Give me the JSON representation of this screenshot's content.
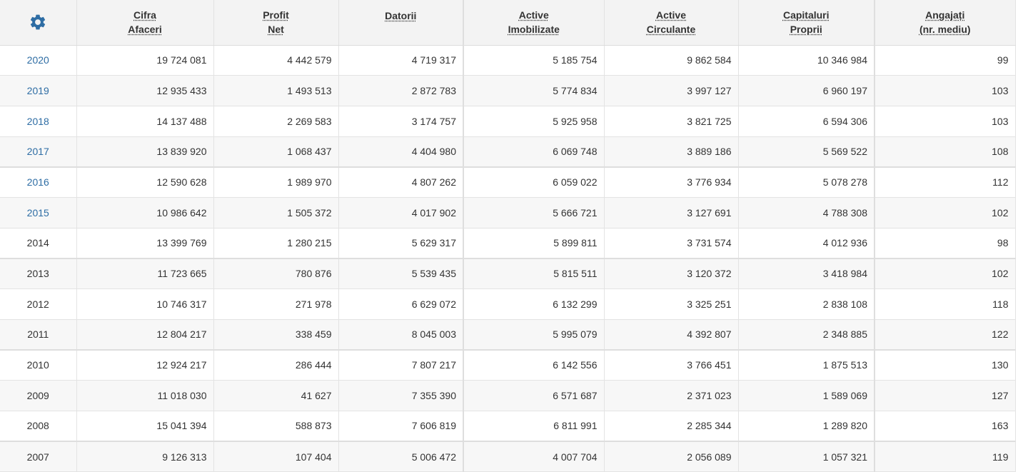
{
  "columns": [
    {
      "key": "settings",
      "icon": "gear-icon"
    },
    {
      "key": "cifra_afaceri",
      "lines": [
        "Cifra",
        "Afaceri"
      ]
    },
    {
      "key": "profit_net",
      "lines": [
        "Profit",
        "Net"
      ]
    },
    {
      "key": "datorii",
      "lines": [
        "Datorii",
        ""
      ]
    },
    {
      "key": "active_imobilizate",
      "lines": [
        "Active",
        "Imobilizate"
      ]
    },
    {
      "key": "active_circulante",
      "lines": [
        "Active",
        "Circulante"
      ]
    },
    {
      "key": "capitaluri_proprii",
      "lines": [
        "Capitaluri",
        "Proprii"
      ]
    },
    {
      "key": "angajati",
      "lines": [
        "Angajați",
        "(nr. mediu)"
      ]
    }
  ],
  "colors": {
    "link": "#2e6da4",
    "gear": "#2e6da4",
    "header_bg": "#f3f3f3",
    "row_alt_bg": "#f7f7f7"
  },
  "rows": [
    {
      "year": "2020",
      "link": true,
      "values": [
        "19 724 081",
        "4 442 579",
        "4 719 317",
        "5 185 754",
        "9 862 584",
        "10 346 984",
        "99"
      ]
    },
    {
      "year": "2019",
      "link": true,
      "values": [
        "12 935 433",
        "1 493 513",
        "2 872 783",
        "5 774 834",
        "3 997 127",
        "6 960 197",
        "103"
      ]
    },
    {
      "year": "2018",
      "link": true,
      "values": [
        "14 137 488",
        "2 269 583",
        "3 174 757",
        "5 925 958",
        "3 821 725",
        "6 594 306",
        "103"
      ]
    },
    {
      "year": "2017",
      "link": true,
      "values": [
        "13 839 920",
        "1 068 437",
        "4 404 980",
        "6 069 748",
        "3 889 186",
        "5 569 522",
        "108"
      ]
    },
    {
      "year": "2016",
      "link": true,
      "values": [
        "12 590 628",
        "1 989 970",
        "4 807 262",
        "6 059 022",
        "3 776 934",
        "5 078 278",
        "112"
      ]
    },
    {
      "year": "2015",
      "link": true,
      "values": [
        "10 986 642",
        "1 505 372",
        "4 017 902",
        "5 666 721",
        "3 127 691",
        "4 788 308",
        "102"
      ]
    },
    {
      "year": "2014",
      "link": false,
      "values": [
        "13 399 769",
        "1 280 215",
        "5 629 317",
        "5 899 811",
        "3 731 574",
        "4 012 936",
        "98"
      ]
    },
    {
      "year": "2013",
      "link": false,
      "values": [
        "11 723 665",
        "780 876",
        "5 539 435",
        "5 815 511",
        "3 120 372",
        "3 418 984",
        "102"
      ]
    },
    {
      "year": "2012",
      "link": false,
      "values": [
        "10 746 317",
        "271 978",
        "6 629 072",
        "6 132 299",
        "3 325 251",
        "2 838 108",
        "118"
      ]
    },
    {
      "year": "2011",
      "link": false,
      "values": [
        "12 804 217",
        "338 459",
        "8 045 003",
        "5 995 079",
        "4 392 807",
        "2 348 885",
        "122"
      ]
    },
    {
      "year": "2010",
      "link": false,
      "values": [
        "12 924 217",
        "286 444",
        "7 807 217",
        "6 142 556",
        "3 766 451",
        "1 875 513",
        "130"
      ]
    },
    {
      "year": "2009",
      "link": false,
      "values": [
        "11 018 030",
        "41 627",
        "7 355 390",
        "6 571 687",
        "2 371 023",
        "1 589 069",
        "127"
      ]
    },
    {
      "year": "2008",
      "link": false,
      "values": [
        "15 041 394",
        "588 873",
        "7 606 819",
        "6 811 991",
        "2 285 344",
        "1 289 820",
        "163"
      ]
    },
    {
      "year": "2007",
      "link": false,
      "values": [
        "9 126 313",
        "107 404",
        "5 006 472",
        "4 007 704",
        "2 056 089",
        "1 057 321",
        "119"
      ]
    }
  ]
}
